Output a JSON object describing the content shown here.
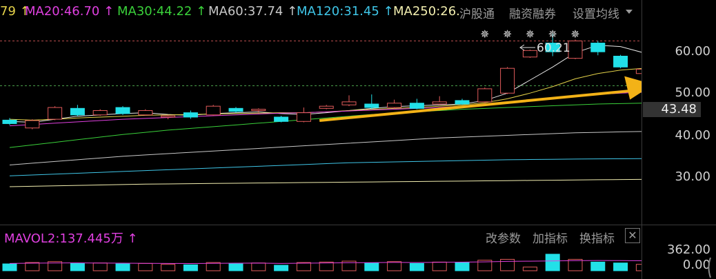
{
  "header": {
    "ma_items": [
      {
        "label": "79 ↑",
        "color": "#e5d34a"
      },
      {
        "label": "MA20:46.70 ↑",
        "color": "#e040e0"
      },
      {
        "label": "MA30:44.22 ↑",
        "color": "#3ad13a"
      },
      {
        "label": "MA60:37.74 ↑",
        "color": "#c8c8c8"
      },
      {
        "label": "MA120:31.45 ↑",
        "color": "#3fc6e8"
      },
      {
        "label": "MA250:26.",
        "color": "#f3efb0"
      }
    ],
    "menu": [
      "沪股通",
      "融资融券",
      "设置均线"
    ]
  },
  "price_axis": {
    "ticks": [
      "60.00",
      "50.00",
      "40.00",
      "30.00"
    ],
    "current": "43.48"
  },
  "annotation": {
    "high_marker": "60.21",
    "star_icon": "snowflake-icon"
  },
  "volume_panel": {
    "label": "MAVOL2:137.445万 ↑",
    "buttons": [
      "改参数",
      "加指标",
      "换指标"
    ],
    "close": "✕",
    "axis_ticks": [
      "362.00",
      "0.00"
    ]
  },
  "colors": {
    "up": "#e35b5b",
    "down": "#22e0e8",
    "arrow": "#f3b217",
    "bg": "#000000"
  },
  "chart_data": {
    "type": "candlestick",
    "ylim": [
      22,
      66
    ],
    "candles": [
      {
        "o": 40.3,
        "c": 39.5,
        "h": 40.8,
        "l": 39.2
      },
      {
        "o": 38.5,
        "c": 40.2,
        "h": 40.5,
        "l": 38.2
      },
      {
        "o": 40.5,
        "c": 43.2,
        "h": 43.5,
        "l": 40.3
      },
      {
        "o": 43.0,
        "c": 41.5,
        "h": 43.8,
        "l": 41.2
      },
      {
        "o": 41.5,
        "c": 42.5,
        "h": 42.8,
        "l": 41.3
      },
      {
        "o": 43.2,
        "c": 41.8,
        "h": 43.5,
        "l": 41.5
      },
      {
        "o": 41.5,
        "c": 42.5,
        "h": 42.8,
        "l": 41.3
      },
      {
        "o": 41.0,
        "c": 41.3,
        "h": 41.5,
        "l": 40.5
      },
      {
        "o": 42.0,
        "c": 41.0,
        "h": 42.5,
        "l": 40.6
      },
      {
        "o": 41.5,
        "c": 43.5,
        "h": 43.8,
        "l": 41.3
      },
      {
        "o": 43.0,
        "c": 42.3,
        "h": 43.3,
        "l": 42.0
      },
      {
        "o": 42.5,
        "c": 42.8,
        "h": 43.0,
        "l": 42.0
      },
      {
        "o": 41.0,
        "c": 40.0,
        "h": 41.3,
        "l": 39.8
      },
      {
        "o": 40.0,
        "c": 42.0,
        "h": 43.2,
        "l": 39.8
      },
      {
        "o": 43.0,
        "c": 43.5,
        "h": 43.8,
        "l": 42.8
      },
      {
        "o": 43.8,
        "c": 44.5,
        "h": 46.0,
        "l": 43.5
      },
      {
        "o": 44.0,
        "c": 43.2,
        "h": 46.2,
        "l": 42.8
      },
      {
        "o": 43.2,
        "c": 44.2,
        "h": 45.0,
        "l": 42.8
      },
      {
        "o": 44.2,
        "c": 43.0,
        "h": 45.2,
        "l": 42.8
      },
      {
        "o": 44.0,
        "c": 44.5,
        "h": 45.8,
        "l": 43.8
      },
      {
        "o": 44.8,
        "c": 44.0,
        "h": 45.2,
        "l": 43.8
      },
      {
        "o": 44.5,
        "c": 47.5,
        "h": 47.8,
        "l": 44.2
      },
      {
        "o": 46.5,
        "c": 52.2,
        "h": 52.5,
        "l": 46.3
      },
      {
        "o": 54.8,
        "c": 56.3,
        "h": 56.5,
        "l": 54.6
      },
      {
        "o": 58.0,
        "c": 56.0,
        "h": 60.21,
        "l": 55.0
      },
      {
        "o": 54.5,
        "c": 58.5,
        "h": 58.8,
        "l": 54.3
      },
      {
        "o": 58.0,
        "c": 56.0,
        "h": 58.5,
        "l": 55.2
      },
      {
        "o": 55.0,
        "c": 52.5,
        "h": 55.3,
        "l": 52.2
      },
      {
        "o": 51.0,
        "c": 52.0,
        "h": 52.3,
        "l": 49.0
      }
    ],
    "volume": {
      "ylim": [
        0,
        362
      ],
      "values": [
        150,
        180,
        200,
        160,
        170,
        150,
        160,
        140,
        130,
        180,
        150,
        170,
        120,
        180,
        190,
        210,
        170,
        200,
        160,
        190,
        180,
        230,
        250,
        80,
        362,
        250,
        190,
        170,
        140
      ],
      "mavol_points": [
        160,
        165,
        170,
        172,
        168,
        165,
        162,
        160,
        158,
        162,
        165,
        168,
        160,
        165,
        170,
        175,
        178,
        182,
        180,
        185,
        188,
        195,
        205,
        210,
        215,
        220,
        225,
        222,
        218
      ]
    },
    "ma_lines": [
      {
        "name": "MA5",
        "color": "#e8e8e8",
        "values": [
          40.0,
          39.8,
          40.5,
          41.2,
          41.5,
          41.8,
          42.0,
          41.6,
          41.4,
          41.8,
          42.0,
          42.2,
          41.8,
          41.6,
          42.0,
          42.5,
          43.0,
          43.4,
          43.6,
          43.8,
          44.0,
          44.8,
          46.5,
          49.5,
          52.5,
          55.8,
          57.5,
          57.2,
          55.8
        ]
      },
      {
        "name": "MA10",
        "color": "#e5d34a",
        "values": [
          40.5,
          40.3,
          40.5,
          40.8,
          41.0,
          41.2,
          41.4,
          41.5,
          41.6,
          41.7,
          41.8,
          41.9,
          42.0,
          42.0,
          42.2,
          42.5,
          42.8,
          43.0,
          43.2,
          43.5,
          43.8,
          44.3,
          45.2,
          46.5,
          48.0,
          49.8,
          51.0,
          51.8,
          52.2
        ]
      },
      {
        "name": "MA20",
        "color": "#e040e0",
        "values": [
          39.0,
          39.3,
          39.6,
          39.9,
          40.2,
          40.5,
          40.7,
          40.9,
          41.1,
          41.3,
          41.5,
          41.7,
          41.9,
          42.0,
          42.2,
          42.4,
          42.6,
          42.8,
          43.0,
          43.2,
          43.5,
          43.8,
          44.2,
          44.7,
          45.2,
          45.7,
          46.2,
          46.5,
          46.7
        ]
      },
      {
        "name": "MA30",
        "color": "#3ad13a",
        "values": [
          34.0,
          34.6,
          35.2,
          35.8,
          36.4,
          37.0,
          37.5,
          38.0,
          38.4,
          38.8,
          39.2,
          39.6,
          40.0,
          40.4,
          40.8,
          41.2,
          41.6,
          41.9,
          42.2,
          42.5,
          42.8,
          43.0,
          43.2,
          43.4,
          43.6,
          43.8,
          44.0,
          44.1,
          44.2
        ]
      },
      {
        "name": "MA60",
        "color": "#c8c8c8",
        "values": [
          30.0,
          30.4,
          30.8,
          31.2,
          31.6,
          32.0,
          32.3,
          32.6,
          32.9,
          33.2,
          33.5,
          33.8,
          34.1,
          34.4,
          34.7,
          35.0,
          35.3,
          35.6,
          35.9,
          36.2,
          36.4,
          36.6,
          36.8,
          37.0,
          37.2,
          37.4,
          37.5,
          37.6,
          37.7
        ]
      },
      {
        "name": "MA120",
        "color": "#3fc6e8",
        "values": [
          27.5,
          27.7,
          27.9,
          28.1,
          28.3,
          28.5,
          28.7,
          28.9,
          29.1,
          29.3,
          29.5,
          29.7,
          29.9,
          30.1,
          30.3,
          30.5,
          30.6,
          30.7,
          30.8,
          30.9,
          31.0,
          31.1,
          31.2,
          31.25,
          31.3,
          31.35,
          31.4,
          31.42,
          31.45
        ]
      },
      {
        "name": "MA250",
        "color": "#f3efb0",
        "values": [
          25.0,
          25.1,
          25.2,
          25.3,
          25.4,
          25.5,
          25.6,
          25.65,
          25.7,
          25.75,
          25.8,
          25.85,
          25.9,
          25.95,
          26.0,
          26.05,
          26.1,
          26.15,
          26.2,
          26.25,
          26.3,
          26.35,
          26.4,
          26.45,
          26.5,
          26.55,
          26.6,
          26.65,
          26.7
        ]
      }
    ],
    "reference_lines": [
      {
        "value": 58.5,
        "color": "#c05050"
      },
      {
        "value": 48.2,
        "color": "#4aa04a"
      }
    ],
    "trend_arrow": {
      "from": [
        14,
        40.2
      ],
      "to": [
        29,
        48.5
      ]
    },
    "star_marks": [
      21,
      22,
      23,
      24,
      25
    ]
  }
}
